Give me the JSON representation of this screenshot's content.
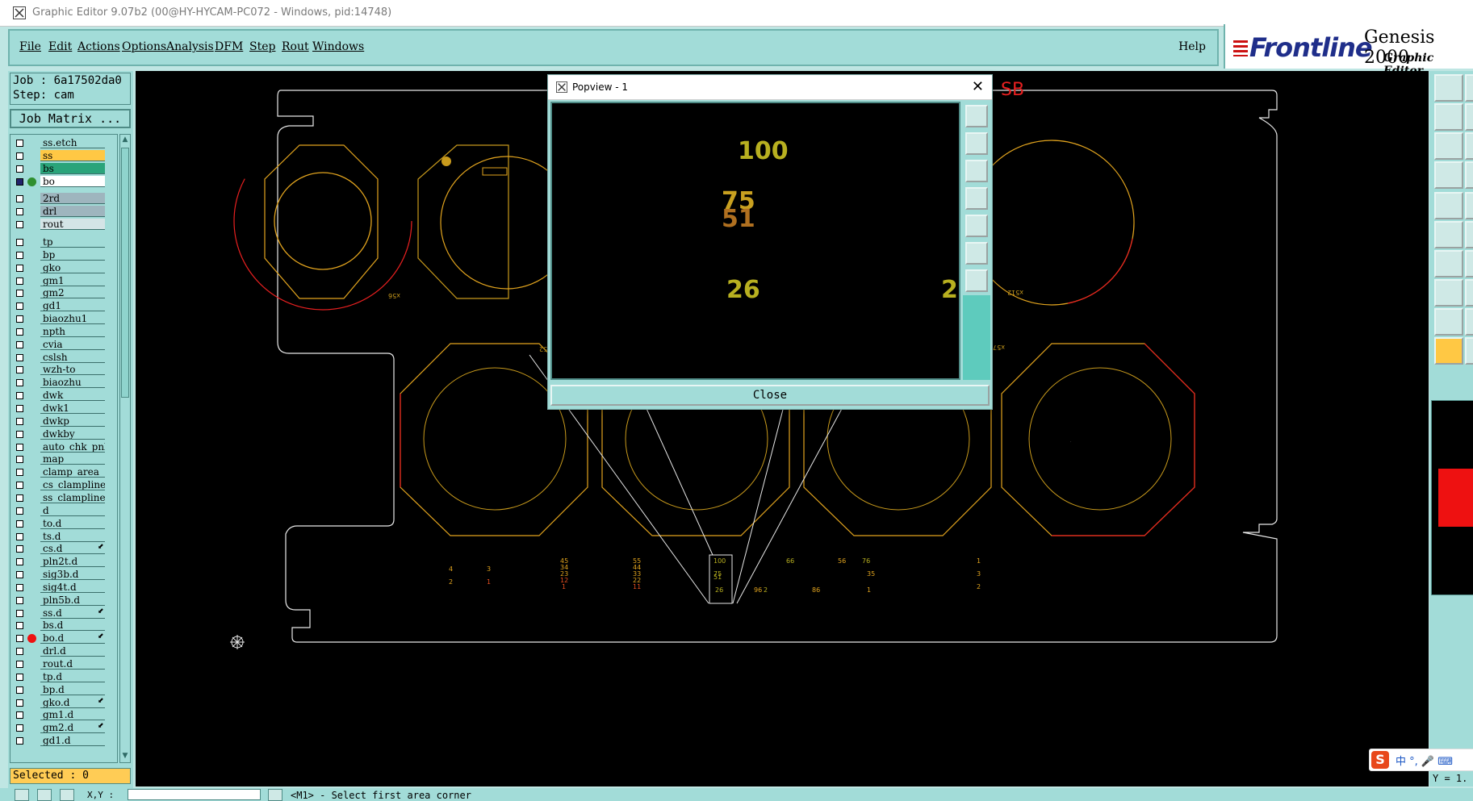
{
  "window": {
    "title": "Graphic Editor 9.07b2 (00@HY-HYCAM-PC072 - Windows, pid:14748)"
  },
  "menu": {
    "items": [
      "File",
      "Edit",
      "Actions",
      "Options",
      "Analysis",
      "DFM",
      "Step",
      "Rout",
      "Windows"
    ],
    "help": "Help"
  },
  "brand": {
    "logo": "Frontline",
    "product": "Genesis 2000",
    "subtitle": "Graphic Editor"
  },
  "job": {
    "job_line": "Job : 6a17502da0",
    "step_line": "Step: cam",
    "matrix_button": "Job Matrix ..."
  },
  "layers": [
    {
      "name": "ss.etch",
      "color": "#a2dcd8",
      "state": "off"
    },
    {
      "name": "ss",
      "color": "#ffc844",
      "state": "off"
    },
    {
      "name": "bs",
      "color": "#2aa47a",
      "state": "off"
    },
    {
      "name": "bo",
      "color": "#ffffff",
      "state": "work",
      "dot": "#2f8f2f"
    },
    {
      "name": "2rd",
      "color": "#9eb5be",
      "state": "off"
    },
    {
      "name": "drl",
      "color": "#9eb5be",
      "state": "off"
    },
    {
      "name": "rout",
      "color": "#d4e4e6",
      "state": "off"
    },
    {
      "name": "tp",
      "color": "#a2dcd8",
      "state": "off"
    },
    {
      "name": "bp",
      "color": "#a2dcd8",
      "state": "off"
    },
    {
      "name": "gko",
      "color": "#a2dcd8",
      "state": "off"
    },
    {
      "name": "gm1",
      "color": "#a2dcd8",
      "state": "off"
    },
    {
      "name": "gm2",
      "color": "#a2dcd8",
      "state": "off"
    },
    {
      "name": "gd1",
      "color": "#a2dcd8",
      "state": "off"
    },
    {
      "name": "biaozhu1",
      "color": "#a2dcd8",
      "state": "off"
    },
    {
      "name": "npth",
      "color": "#a2dcd8",
      "state": "off"
    },
    {
      "name": "cvia",
      "color": "#a2dcd8",
      "state": "off"
    },
    {
      "name": "cslsh",
      "color": "#a2dcd8",
      "state": "off"
    },
    {
      "name": "wzh-to",
      "color": "#a2dcd8",
      "state": "off"
    },
    {
      "name": "biaozhu",
      "color": "#a2dcd8",
      "state": "off"
    },
    {
      "name": "dwk",
      "color": "#a2dcd8",
      "state": "off"
    },
    {
      "name": "dwk1",
      "color": "#a2dcd8",
      "state": "off"
    },
    {
      "name": "dwkp",
      "color": "#a2dcd8",
      "state": "off"
    },
    {
      "name": "dwkby",
      "color": "#a2dcd8",
      "state": "off"
    },
    {
      "name": "auto_chk_pnl",
      "color": "#a2dcd8",
      "state": "off"
    },
    {
      "name": "map",
      "color": "#a2dcd8",
      "state": "off"
    },
    {
      "name": "clamp_area",
      "color": "#a2dcd8",
      "state": "off"
    },
    {
      "name": "cs_clampline",
      "color": "#a2dcd8",
      "state": "off"
    },
    {
      "name": "ss_clampline",
      "color": "#a2dcd8",
      "state": "off"
    },
    {
      "name": "d",
      "color": "#a2dcd8",
      "state": "off"
    },
    {
      "name": "to.d",
      "color": "#a2dcd8",
      "state": "off"
    },
    {
      "name": "ts.d",
      "color": "#a2dcd8",
      "state": "off"
    },
    {
      "name": "cs.d",
      "color": "#a2dcd8",
      "state": "off",
      "lock": true
    },
    {
      "name": "pln2t.d",
      "color": "#a2dcd8",
      "state": "off"
    },
    {
      "name": "sig3b.d",
      "color": "#a2dcd8",
      "state": "off"
    },
    {
      "name": "sig4t.d",
      "color": "#a2dcd8",
      "state": "off"
    },
    {
      "name": "pln5b.d",
      "color": "#a2dcd8",
      "state": "off"
    },
    {
      "name": "ss.d",
      "color": "#a2dcd8",
      "state": "off",
      "lock": true
    },
    {
      "name": "bs.d",
      "color": "#a2dcd8",
      "state": "off"
    },
    {
      "name": "bo.d",
      "color": "#a2dcd8",
      "state": "off",
      "dot": "#ee1111",
      "lock": true
    },
    {
      "name": "drl.d",
      "color": "#a2dcd8",
      "state": "off"
    },
    {
      "name": "rout.d",
      "color": "#a2dcd8",
      "state": "off"
    },
    {
      "name": "tp.d",
      "color": "#a2dcd8",
      "state": "off"
    },
    {
      "name": "bp.d",
      "color": "#a2dcd8",
      "state": "off"
    },
    {
      "name": "gko.d",
      "color": "#a2dcd8",
      "state": "off",
      "lock": true
    },
    {
      "name": "gm1.d",
      "color": "#a2dcd8",
      "state": "off"
    },
    {
      "name": "gm2.d",
      "color": "#a2dcd8",
      "state": "off",
      "lock": true
    },
    {
      "name": "gd1.d",
      "color": "#a2dcd8",
      "state": "off"
    }
  ],
  "selected": "Selected : 0",
  "canvas": {
    "label": "SB",
    "hole_labels": [
      "x56",
      "x511",
      "x512",
      "x52",
      "x55",
      "x56",
      "x57"
    ],
    "small_numbers": [
      "4",
      "2",
      "3",
      "1",
      "45",
      "34",
      "23",
      "12",
      "1",
      "55",
      "44",
      "33",
      "22",
      "11",
      "100",
      "75",
      "51",
      "26",
      "2",
      "76",
      "35",
      "1",
      "66",
      "56",
      "86",
      "96",
      "1",
      "3",
      "2"
    ]
  },
  "popview": {
    "title": "Popview - 1",
    "numbers": [
      "100",
      "75",
      "51",
      "26",
      "2"
    ],
    "close_label": "Close"
  },
  "statusbar": {
    "xy_label": "X,Y :",
    "prompt": "<M1> - Select first area corner",
    "y_readout": "Y = 1."
  },
  "ime": {
    "text": "中 °, 🎤 ⌨"
  }
}
